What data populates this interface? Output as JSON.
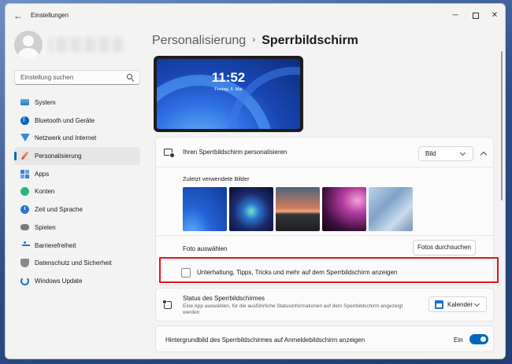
{
  "window": {
    "title": "Einstellungen",
    "back_symbol": "←",
    "minimize_symbol": "─",
    "close_symbol": "✕"
  },
  "search": {
    "placeholder": "Einstellung suchen"
  },
  "sidebar": {
    "items": [
      {
        "label": "System",
        "icon": "system-icon"
      },
      {
        "label": "Bluetooth und Geräte",
        "icon": "bluetooth-icon"
      },
      {
        "label": "Netzwerk und Internet",
        "icon": "wifi-icon"
      },
      {
        "label": "Personalisierung",
        "icon": "paintbrush-icon",
        "active": true
      },
      {
        "label": "Apps",
        "icon": "apps-icon"
      },
      {
        "label": "Konten",
        "icon": "account-icon"
      },
      {
        "label": "Zeit und Sprache",
        "icon": "clock-globe-icon"
      },
      {
        "label": "Spielen",
        "icon": "gamepad-icon"
      },
      {
        "label": "Barrierefreiheit",
        "icon": "accessibility-icon"
      },
      {
        "label": "Datenschutz und Sicherheit",
        "icon": "shield-icon"
      },
      {
        "label": "Windows Update",
        "icon": "update-icon"
      }
    ]
  },
  "breadcrumb": {
    "parent": "Personalisierung",
    "separator": "›",
    "current": "Sperrbildschirm"
  },
  "preview": {
    "time": "11:52",
    "date": "Freitag, 5. Mai"
  },
  "personalize": {
    "label": "Ihren Sperrbildschirm personalisieren",
    "dropdown_value": "Bild",
    "recent_label": "Zuletzt verwendete Bilder",
    "choose_label": "Foto auswählen",
    "browse_button": "Fotos durchsuchen"
  },
  "tips": {
    "label": "Unterhaltung, Tipps, Tricks und mehr auf dem Sperrbildschirm anzeigen",
    "checked": false
  },
  "status": {
    "title": "Status des Sperrbildschirmes",
    "description": "Eine App auswählen, für die ausführliche Statusinformationen auf dem Sperrbildschirm angezeigt werden",
    "dropdown_value": "Kalender"
  },
  "background": {
    "label": "Hintergrundbild des Sperrbildschirmes auf Anmeldebildschirm anzeigen",
    "state_label": "Ein",
    "toggle_on": true
  },
  "colors": {
    "accent": "#0067c0",
    "highlight": "#e0161b"
  }
}
